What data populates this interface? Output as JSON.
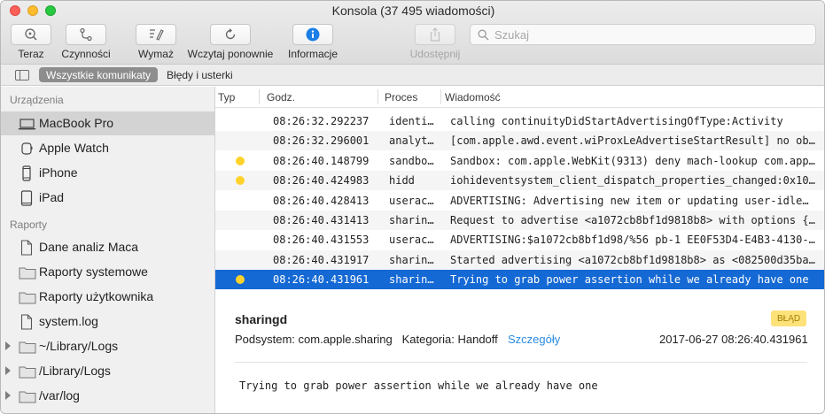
{
  "window": {
    "title": "Konsola (37 495 wiadomości)"
  },
  "toolbar": {
    "now": "Teraz",
    "activities": "Czynności",
    "clear": "Wymaż",
    "reload": "Wczytaj ponownie",
    "info": "Informacje",
    "share": "Udostępnij",
    "search_placeholder": "Szukaj"
  },
  "filters": {
    "all": "Wszystkie komunikaty",
    "errors": "Błędy i usterki"
  },
  "sidebar": {
    "devices_header": "Urządzenia",
    "devices": [
      {
        "label": "MacBook Pro",
        "icon": "laptop-icon"
      },
      {
        "label": "Apple Watch",
        "icon": "watch-icon"
      },
      {
        "label": "iPhone",
        "icon": "iphone-icon"
      },
      {
        "label": "iPad",
        "icon": "ipad-icon"
      }
    ],
    "reports_header": "Raporty",
    "reports": [
      {
        "label": "Dane analiz Maca",
        "icon": "document-icon"
      },
      {
        "label": "Raporty systemowe",
        "icon": "folder-icon"
      },
      {
        "label": "Raporty użytkownika",
        "icon": "folder-icon"
      },
      {
        "label": "system.log",
        "icon": "document-icon"
      },
      {
        "label": "~/Library/Logs",
        "icon": "folder-icon"
      },
      {
        "label": "/Library/Logs",
        "icon": "folder-icon"
      },
      {
        "label": "/var/log",
        "icon": "folder-icon"
      }
    ]
  },
  "columns": {
    "type": "Typ",
    "time": "Godz.",
    "process": "Proces",
    "message": "Wiadomość"
  },
  "rows": [
    {
      "dot": false,
      "time": "08:26:32.292237",
      "process": "identi…",
      "message": "calling continuityDidStartAdvertisingOfType:Activity"
    },
    {
      "dot": false,
      "time": "08:26:32.296001",
      "process": "analyt…",
      "message": "[com.apple.awd.event.wiProxLeAdvertiseStartResult] no ob…"
    },
    {
      "dot": true,
      "time": "08:26:40.148799",
      "process": "sandbo…",
      "message": "Sandbox: com.apple.WebKit(9313) deny mach-lookup com.app…"
    },
    {
      "dot": true,
      "time": "08:26:40.424983",
      "process": "hidd",
      "message": "iohideventsystem_client_dispatch_properties_changed:0x10…"
    },
    {
      "dot": false,
      "time": "08:26:40.428413",
      "process": "userac…",
      "message": "ADVERTISING: Advertising new item or updating user-idle…"
    },
    {
      "dot": false,
      "time": "08:26:40.431413",
      "process": "sharin…",
      "message": "Request to advertise <a1072cb8bf1d9818b8> with options {…"
    },
    {
      "dot": false,
      "time": "08:26:40.431553",
      "process": "userac…",
      "message": "ADVERTISING:$a1072cb8bf1d98/%56 pb-1 EE0F53D4-E4B3-4130-…"
    },
    {
      "dot": false,
      "time": "08:26:40.431917",
      "process": "sharin…",
      "message": "Started advertising <a1072cb8bf1d9818b8> as <082500d35ba…"
    },
    {
      "dot": true,
      "time": "08:26:40.431961",
      "process": "sharin…",
      "message": "Trying to grab power assertion while we already have one"
    }
  ],
  "detail": {
    "process": "sharingd",
    "badge": "BŁĄD",
    "subsystem": "Podsystem: com.apple.sharing",
    "category": "Kategoria: Handoff",
    "details_link": "Szczegóły",
    "date": "2017-06-27 08:26:40.431961",
    "message": "Trying to grab power assertion while we already have one"
  },
  "colors": {
    "selection": "#1569d4",
    "warning_dot": "#ffd22b",
    "badge_bg": "#fde27a",
    "link": "#2a8be0"
  }
}
